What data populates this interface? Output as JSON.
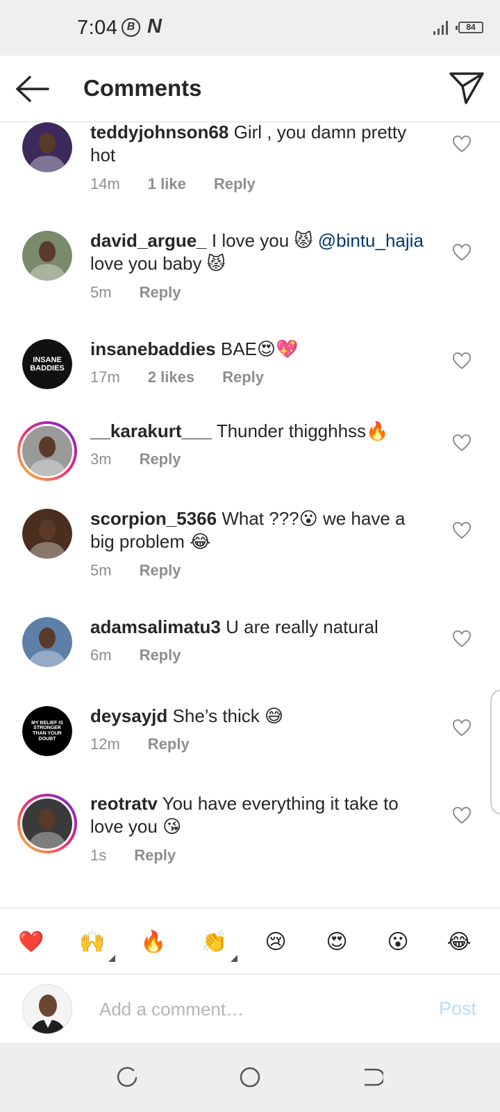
{
  "status_bar": {
    "time": "7:04",
    "b_badge": "B",
    "n_badge": "N",
    "battery": "84"
  },
  "header": {
    "title": "Comments",
    "back_icon": "arrow-left-icon",
    "share_icon": "send-icon"
  },
  "comments": [
    {
      "username": "teddyjohnson68",
      "parts": [
        {
          "t": "Girl , you damn pretty hot"
        }
      ],
      "time": "14m",
      "likes": "1 like",
      "reply": "Reply",
      "avatar_color": "#3b2a5a",
      "story": false
    },
    {
      "username": "david_argue_",
      "parts": [
        {
          "t": "I love you "
        },
        {
          "emoji": "😾"
        },
        {
          "t": " "
        },
        {
          "mention": "@bintu_hajia"
        },
        {
          "t": " love you baby "
        },
        {
          "emoji": "😾"
        }
      ],
      "time": "5m",
      "likes": "",
      "reply": "Reply",
      "avatar_color": "#7a8a6a",
      "story": false
    },
    {
      "username": "insanebaddies",
      "parts": [
        {
          "t": "BAE"
        },
        {
          "emoji": "😍"
        },
        {
          "emoji": "💖"
        }
      ],
      "time": "17m",
      "likes": "2 likes",
      "reply": "Reply",
      "avatar_color": "#111111",
      "avatar_text": "INSANE BADDIES",
      "story": false
    },
    {
      "username": "__karakurt___",
      "parts": [
        {
          "t": "Thunder thigghhss"
        },
        {
          "emoji": "🔥"
        }
      ],
      "time": "3m",
      "likes": "",
      "reply": "Reply",
      "avatar_color": "#9a9a9a",
      "story": true
    },
    {
      "username": "scorpion_5366",
      "parts": [
        {
          "t": "What ???"
        },
        {
          "emoji": "😮"
        },
        {
          "t": " we have a big problem "
        },
        {
          "emoji": "😂"
        }
      ],
      "time": "5m",
      "likes": "",
      "reply": "Reply",
      "avatar_color": "#4a2e1e",
      "story": false
    },
    {
      "username": "adamsalimatu3",
      "parts": [
        {
          "t": "U are really natural"
        }
      ],
      "time": "6m",
      "likes": "",
      "reply": "Reply",
      "avatar_color": "#5d7fa8",
      "story": false
    },
    {
      "username": "deysayjd",
      "parts": [
        {
          "t": "She’s thick "
        },
        {
          "emoji": "😅"
        }
      ],
      "time": "12m",
      "likes": "",
      "reply": "Reply",
      "avatar_color": "#000000",
      "avatar_text": "MY BELIEF IS STRONGER THAN YOUR DOUBT",
      "story": false
    },
    {
      "username": "reotratv",
      "parts": [
        {
          "t": "You have everything it take to love you "
        },
        {
          "emoji": "😘"
        }
      ],
      "time": "1s",
      "likes": "",
      "reply": "Reply",
      "avatar_color": "#3a3a3a",
      "story": true
    }
  ],
  "reactions": [
    "❤️",
    "🙌",
    "🔥",
    "👏",
    "😢",
    "😍",
    "😮",
    "😂"
  ],
  "composer": {
    "placeholder": "Add a comment…",
    "post_label": "Post"
  },
  "colors": {
    "link": "#00376b",
    "meta": "#8e8e8e",
    "post_disabled": "#b2dffc"
  }
}
